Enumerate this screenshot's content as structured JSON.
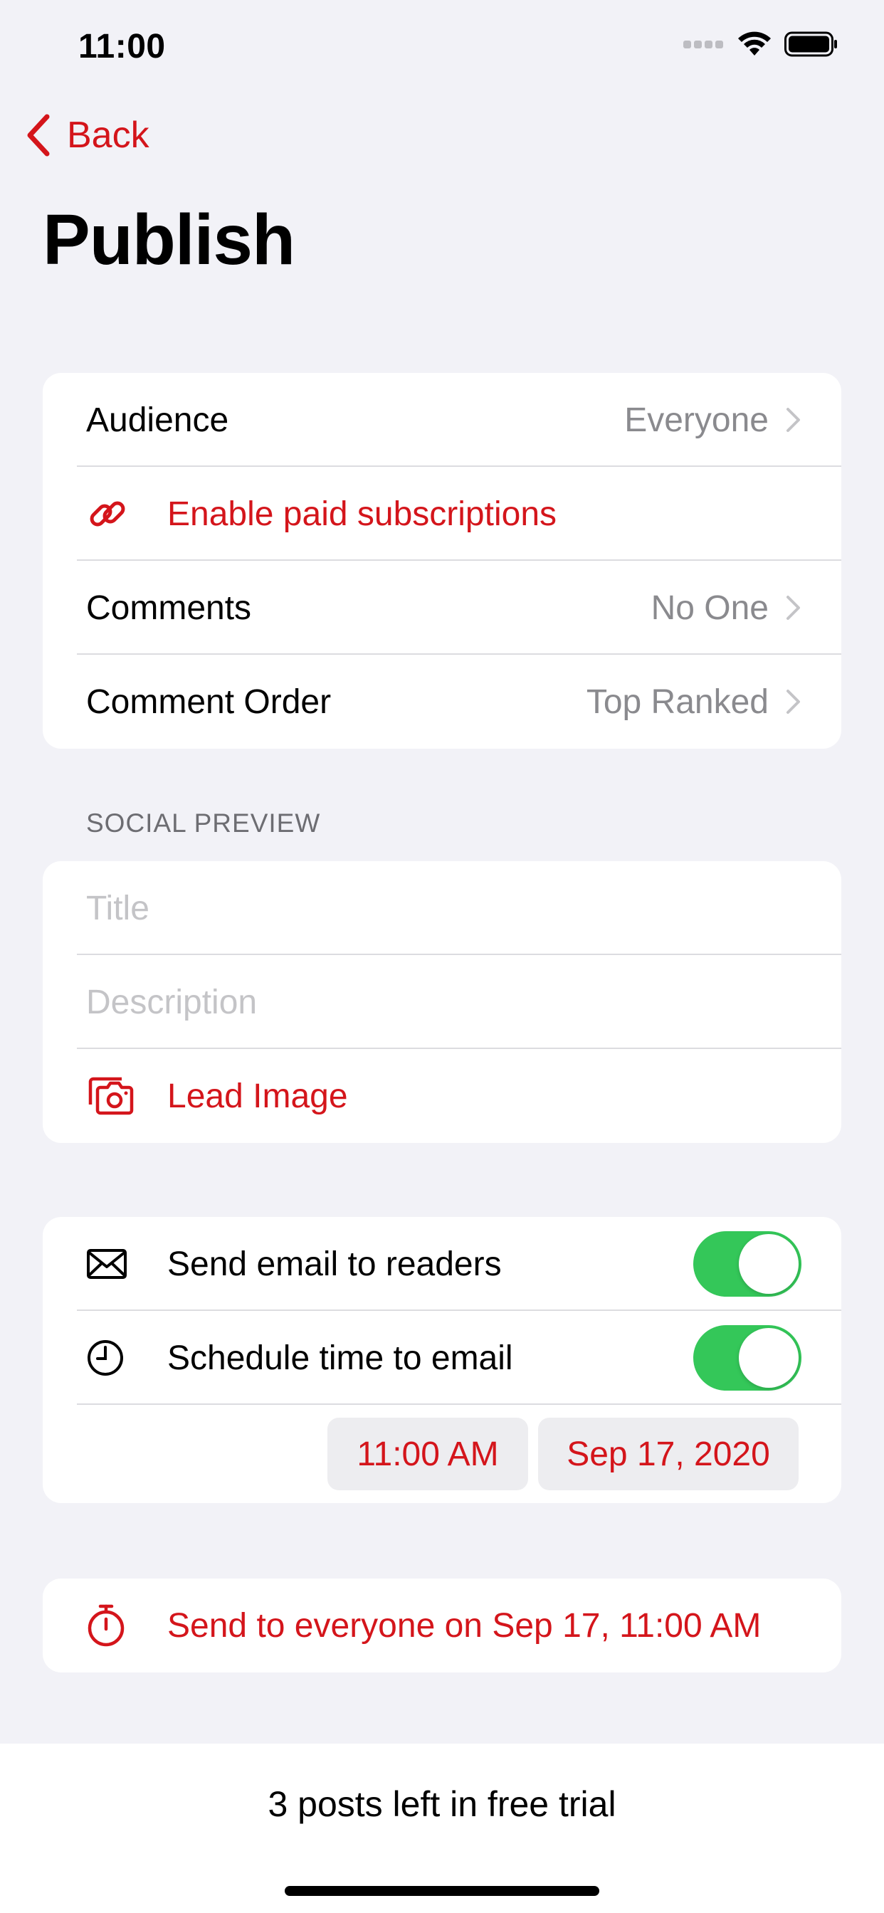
{
  "status_bar": {
    "time": "11:00"
  },
  "nav": {
    "back_label": "Back",
    "title": "Publish"
  },
  "settings": {
    "audience_label": "Audience",
    "audience_value": "Everyone",
    "paid_label": "Enable paid subscriptions",
    "comments_label": "Comments",
    "comments_value": "No One",
    "comment_order_label": "Comment Order",
    "comment_order_value": "Top Ranked"
  },
  "social_preview": {
    "header": "SOCIAL PREVIEW",
    "title_placeholder": "Title",
    "description_placeholder": "Description",
    "lead_image_label": "Lead Image"
  },
  "email": {
    "send_label": "Send email to readers",
    "send_enabled": true,
    "schedule_label": "Schedule time to email",
    "schedule_enabled": true,
    "time_value": "11:00 AM",
    "date_value": "Sep 17, 2020"
  },
  "action": {
    "send_label": "Send to everyone on Sep 17, 11:00 AM"
  },
  "footer": {
    "trial_text": "3 posts left in free trial"
  },
  "colors": {
    "accent": "#d4151b",
    "toggle_on": "#34c759",
    "background": "#f2f2f7"
  }
}
